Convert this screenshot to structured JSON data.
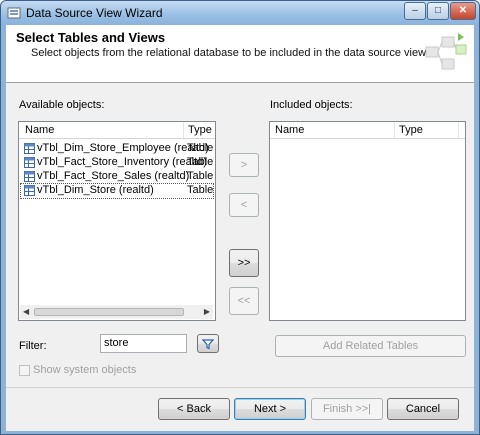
{
  "window": {
    "title": "Data Source View Wizard"
  },
  "title_buttons": {
    "minimize": "–",
    "maximize": "□",
    "close": "✕"
  },
  "header": {
    "title": "Select Tables and Views",
    "subtitle": "Select objects from the relational database to be included in the data source view."
  },
  "available": {
    "label": "Available objects:",
    "columns": {
      "name": "Name",
      "type": "Type"
    },
    "items": [
      {
        "name": "vTbl_Dim_Store_Employee (realtd)",
        "type": "Table"
      },
      {
        "name": "vTbl_Fact_Store_Inventory (realtd)",
        "type": "Table"
      },
      {
        "name": "vTbl_Fact_Store_Sales (realtd)",
        "type": "Table"
      },
      {
        "name": "vTbl_Dim_Store (realtd)",
        "type": "Table"
      }
    ]
  },
  "included": {
    "label": "Included objects:",
    "columns": {
      "name": "Name",
      "type": "Type"
    }
  },
  "transfer": {
    "add": ">",
    "remove": "<",
    "add_all": ">>",
    "remove_all": "<<"
  },
  "filter": {
    "label": "Filter:",
    "value": "store"
  },
  "add_related": "Add Related Tables",
  "show_system": "Show system objects",
  "footer": {
    "back": "< Back",
    "next": "Next >",
    "finish": "Finish >>|",
    "cancel": "Cancel"
  },
  "icons": {
    "window": "wizard-icon",
    "filter": "funnel-icon",
    "table": "table-icon",
    "graphic": "network-graphic-icon"
  },
  "colors": {
    "accent": "#3c7fb1",
    "titlebar": "#9cc0e4",
    "filter_icon": "#2a5fb0"
  }
}
